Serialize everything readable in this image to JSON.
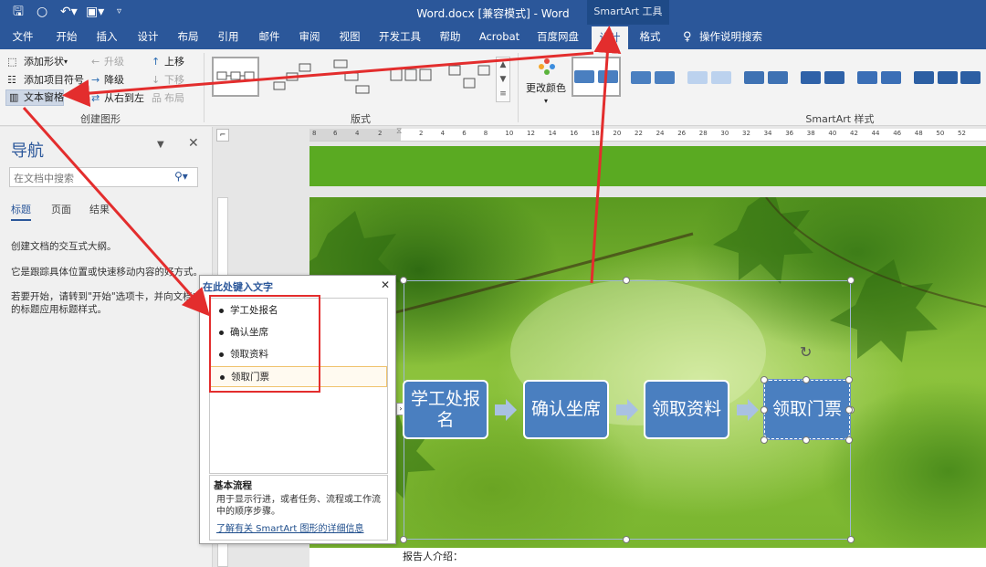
{
  "window": {
    "title": "Word.docx [兼容模式]  -  Word",
    "contextual_group": "SmartArt 工具"
  },
  "tabs": [
    {
      "label": "文件"
    },
    {
      "label": "开始"
    },
    {
      "label": "插入"
    },
    {
      "label": "设计"
    },
    {
      "label": "布局"
    },
    {
      "label": "引用"
    },
    {
      "label": "邮件"
    },
    {
      "label": "审阅"
    },
    {
      "label": "视图"
    },
    {
      "label": "开发工具"
    },
    {
      "label": "帮助"
    },
    {
      "label": "Acrobat"
    },
    {
      "label": "百度网盘"
    },
    {
      "label": "设计",
      "active": true
    },
    {
      "label": "格式"
    },
    {
      "label": "操作说明搜索"
    }
  ],
  "ribbon": {
    "create": {
      "add_shape": "添加形状",
      "add_bullet": "添加项目符号",
      "text_pane": "文本窗格",
      "promote": "升级",
      "demote": "降级",
      "right_to_left": "从右到左",
      "move_up": "上移",
      "move_down": "下移",
      "layout": "布局",
      "group_label": "创建图形"
    },
    "layouts_label": "版式",
    "change_colors": "更改颜色",
    "styles_label": "SmartArt 样式"
  },
  "nav": {
    "title": "导航",
    "search_placeholder": "在文档中搜索",
    "tabs": [
      "标题",
      "页面",
      "结果"
    ],
    "text1": "创建文档的交互式大纲。",
    "text2": "它是跟踪具体位置或快速移动内容的好方式。",
    "text3": "若要开始，请转到\"开始\"选项卡，并向文档中的标题应用标题样式。"
  },
  "ruler": {
    "left_ticks": [
      "8",
      "6",
      "4",
      "2"
    ],
    "ticks": [
      "2",
      "4",
      "6",
      "8",
      "10",
      "12",
      "14",
      "16",
      "18",
      "20",
      "22",
      "24",
      "26",
      "28",
      "30",
      "32",
      "34",
      "36",
      "38",
      "40",
      "42",
      "44",
      "46",
      "48",
      "50",
      "52"
    ]
  },
  "text_pane": {
    "title": "在此处键入文字",
    "items": [
      "学工处报名",
      "确认坐席",
      "领取资料",
      "领取门票"
    ],
    "info_title": "基本流程",
    "info_desc": "用于显示行进，或者任务、流程或工作流中的顺序步骤。",
    "info_link": "了解有关 SmartArt 图形的详细信息"
  },
  "smartart": {
    "boxes": [
      "学工处报名",
      "确认坐席",
      "领取资料",
      "领取门票"
    ],
    "box_color": "#4a7fc0",
    "arrow_color": "#a9c1e2"
  },
  "document": {
    "reporter_label": "报告人介绍："
  },
  "colors": {
    "title_bar": "#2b579a",
    "annotation": "#e32d2d"
  }
}
